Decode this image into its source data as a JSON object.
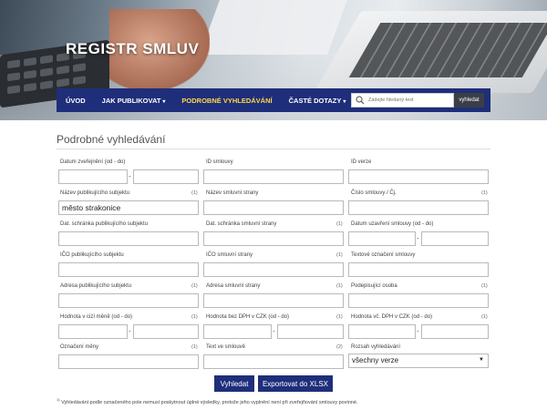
{
  "header": {
    "title": "REGISTR SMLUV"
  },
  "nav": {
    "items": [
      {
        "label": "ÚVOD",
        "dropdown": false,
        "active": false
      },
      {
        "label": "JAK PUBLIKOVAT",
        "dropdown": true,
        "active": false
      },
      {
        "label": "PODROBNÉ VYHLEDÁVÁNÍ",
        "dropdown": false,
        "active": true
      },
      {
        "label": "ČASTÉ DOTAZY",
        "dropdown": true,
        "active": false
      }
    ],
    "search_placeholder": "Zadejte hledaný text",
    "search_button": "vyhledat"
  },
  "page": {
    "title": "Podrobné vyhledávání"
  },
  "form": {
    "datum_zverejneni": "Datum zveřejnění (od - do)",
    "id_smlouvy": "ID smlouvy",
    "id_verze": "ID verze",
    "nazev_publ_subjektu": "Název publikujícího subjektu",
    "nazev_publ_subjektu_value": "město strakonice",
    "nazev_smluvni_strany": "Název smluvní strany",
    "cislo_smlouvy": "Číslo smlouvy / Čj.",
    "dat_schranka_publ": "Dat. schránka publikujícího subjektu",
    "dat_schranka_smluvni": "Dat. schránka smluvní strany",
    "datum_uzavreni": "Datum uzavření smlouvy (od - do)",
    "ico_publ": "IČO publikujícího subjektu",
    "ico_smluvni": "IČO smluvní strany",
    "textove_oznaceni": "Textové označení smlouvy",
    "adresa_publ": "Adresa publikujícího subjektu",
    "adresa_smluvni": "Adresa smluvní strany",
    "podepisujici": "Podepisující osoba",
    "hodnota_cizi": "Hodnota v cizí měně (od - do)",
    "hodnota_bez_dph": "Hodnota bez DPH v CZK (od - do)",
    "hodnota_vc_dph": "Hodnota vč. DPH v CZK (od - do)",
    "oznaceni_meny": "Označení měny",
    "text_ve_smlouve": "Text ve smlouvě",
    "rozsah": "Rozsah vyhledávání",
    "rozsah_value": "všechny verze",
    "note1": "(1)",
    "note2": "(2)",
    "dash": "-"
  },
  "buttons": {
    "search": "Vyhledat",
    "export": "Exportovat do XLSX"
  },
  "footnote": {
    "marker": "1)",
    "text": " Vyhledávání podle označeného pole nemusí poskytnout úplné výsledky, protože jeho vyplnění není při zveřejňování smlouvy povinné."
  },
  "colors": {
    "nav_bg": "#1f2e7a",
    "nav_active": "#ffd84a",
    "button_bg": "#1f2e7a"
  },
  "icons": {
    "search": "magnifier-icon",
    "select_arrow": "triangle-down-icon"
  }
}
